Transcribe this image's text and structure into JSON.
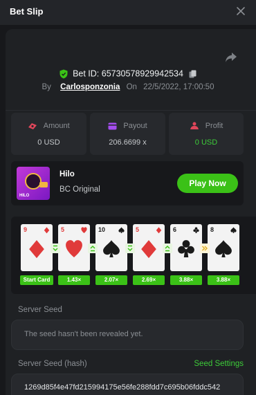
{
  "header": {
    "title": "Bet Slip"
  },
  "bet": {
    "id_text": "Bet ID: 65730578929942534",
    "by_label": "By",
    "user": "Carlosponzonia",
    "on_label": "On",
    "datetime": "22/5/2022, 17:00:50"
  },
  "stats": {
    "amount": {
      "label": "Amount",
      "value": "0 USD"
    },
    "payout": {
      "label": "Payout",
      "value": "206.6699 x"
    },
    "profit": {
      "label": "Profit",
      "value": "0 USD"
    }
  },
  "game": {
    "name": "Hilo",
    "subtitle": "BC Original",
    "thumb_label": "HILO",
    "play_label": "Play Now"
  },
  "cards": [
    {
      "rank": "9",
      "suit": "diamond"
    },
    {
      "rank": "5",
      "suit": "heart"
    },
    {
      "rank": "10",
      "suit": "spade"
    },
    {
      "rank": "5",
      "suit": "diamond"
    },
    {
      "rank": "6",
      "suit": "club"
    },
    {
      "rank": "8",
      "suit": "spade"
    }
  ],
  "guesses": [
    "lower",
    "higher",
    "lower",
    "higher",
    "skip"
  ],
  "multipliers": [
    "Start Card",
    "1.43×",
    "2.07×",
    "2.69×",
    "3.88×",
    "3.88×"
  ],
  "seeds": {
    "server_seed_label": "Server Seed",
    "server_seed_text": "The seed hasn't been revealed yet.",
    "hash_label": "Server Seed (hash)",
    "settings_label": "Seed Settings",
    "hash_value": "1269d85f4e47fd215994175e56fe288fdd7c695b06fddc542"
  },
  "colors": {
    "accent_green": "#3bc117",
    "card_red": "#e03a3a",
    "card_black": "#1a1a1a",
    "background": "#17181b",
    "panel": "#1f2124"
  }
}
